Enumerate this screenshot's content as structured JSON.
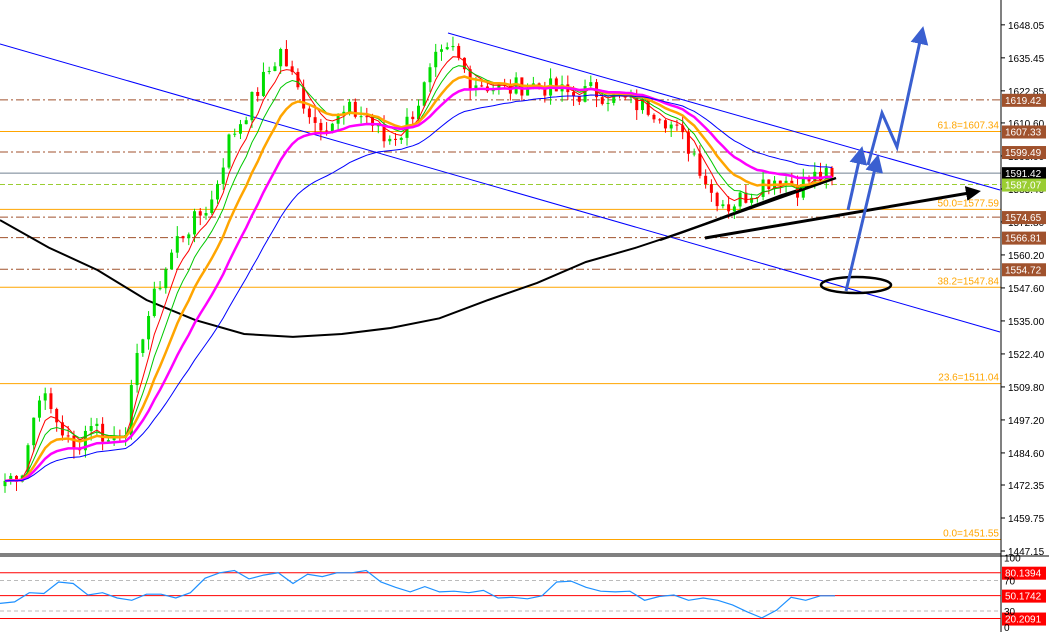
{
  "chart_data": {
    "type": "candlestick",
    "price_axis": {
      "ylim": [
        1447.15,
        1655
      ],
      "ticks": [
        "1648.05",
        "1635.45",
        "1622.85",
        "1610.60",
        "1598.00",
        "1585.40",
        "1572.80",
        "1560.20",
        "1547.60",
        "1535.00",
        "1522.40",
        "1509.80",
        "1497.20",
        "1484.60",
        "1472.35",
        "1459.75",
        "1447.15"
      ]
    },
    "closes": [
      1474,
      1478,
      1508,
      1497,
      1485,
      1497,
      1489,
      1495,
      1531,
      1550,
      1566,
      1573,
      1581,
      1604,
      1615,
      1627,
      1638,
      1623,
      1611,
      1611,
      1615,
      1613,
      1604,
      1607,
      1619,
      1634,
      1638,
      1627,
      1625,
      1623,
      1625,
      1625,
      1623,
      1621,
      1623,
      1621,
      1619,
      1617,
      1615,
      1607,
      1599,
      1584,
      1579,
      1583,
      1588,
      1590,
      1586,
      1590,
      1590
    ],
    "ma200": [
      1573.5,
      1563,
      1554.4,
      1543,
      1535.3,
      1530,
      1528.9,
      1530,
      1532.3,
      1536,
      1543,
      1549.5,
      1557.5,
      1562.8,
      1569,
      1576,
      1583,
      1588.8
    ],
    "ma_periods": [
      5,
      8,
      13,
      21,
      34
    ],
    "ma_colors": [
      "#ff0000",
      "#00c800",
      "#ffa500",
      "#ff00ff",
      "#0000ff"
    ],
    "candle_up_color": "#00dd00",
    "candle_down_color": "#ff0000",
    "fib_levels": [
      {
        "label": "61.8=1607.34",
        "price": 1607.34
      },
      {
        "label": "50.0=1577.59",
        "price": 1577.59
      },
      {
        "label": "38.2=1547.84",
        "price": 1547.84
      },
      {
        "label": "23.6=1511.04",
        "price": 1511.04
      },
      {
        "label": "0.0=1451.55",
        "price": 1451.55
      }
    ],
    "fib_color": "#ffa500",
    "sr_levels": [
      {
        "label": "1619.42",
        "price": 1619.42
      },
      {
        "label": "1607.33",
        "price": 1607.33,
        "solid": true
      },
      {
        "label": "1599.49",
        "price": 1599.49
      },
      {
        "label": "1574.65",
        "price": 1574.65
      },
      {
        "label": "1566.81",
        "price": 1566.81
      },
      {
        "label": "1554.72",
        "price": 1554.72
      }
    ],
    "sr_color": "#a0522d",
    "bid": {
      "label": "1591.42",
      "price": 1591.42,
      "color": "#000000"
    },
    "ask": {
      "label": "1587.07",
      "price": 1587.07,
      "color": "#9acd32"
    },
    "rsi": {
      "ticks": [
        "100",
        "70",
        "30",
        "0"
      ],
      "levels": [
        {
          "label": "80.1394",
          "value": 80.1394
        },
        {
          "label": "50.1742",
          "value": 50.1742
        },
        {
          "label": "20.2091",
          "value": 20.2091
        }
      ],
      "values": [
        40,
        42,
        54,
        53,
        68,
        66,
        51,
        54,
        47,
        44,
        52,
        52,
        47,
        54,
        73,
        80,
        83,
        72,
        77,
        80,
        66,
        78,
        75,
        80,
        80,
        83,
        68,
        61,
        55,
        62,
        55,
        56,
        54,
        57,
        47,
        48,
        46,
        50,
        68,
        69,
        61,
        56,
        55,
        56,
        44,
        49,
        51,
        44,
        47,
        44,
        38,
        29,
        21,
        31,
        48,
        44,
        50,
        50
      ],
      "color": "#1e90ff",
      "level_color": "#ff0000"
    }
  }
}
